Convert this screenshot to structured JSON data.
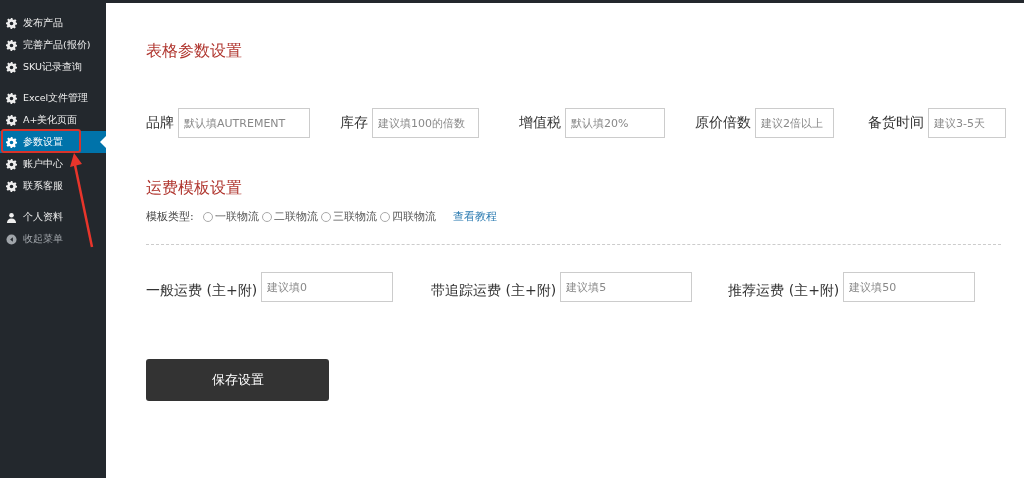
{
  "sidebar": {
    "groups": [
      {
        "items": [
          {
            "label": "发布产品",
            "kind": "gear",
            "selected": false
          },
          {
            "label": "完善产品(报价)",
            "kind": "gear",
            "selected": false
          },
          {
            "label": "SKU记录查询",
            "kind": "gear",
            "selected": false
          }
        ]
      },
      {
        "items": [
          {
            "label": "Excel文件管理",
            "kind": "gear",
            "selected": false
          },
          {
            "label": "A+美化页面",
            "kind": "gear",
            "selected": false
          },
          {
            "label": "参数设置",
            "kind": "gear",
            "selected": true
          },
          {
            "label": "账户中心",
            "kind": "gear",
            "selected": false
          },
          {
            "label": "联系客服",
            "kind": "gear",
            "selected": false
          }
        ]
      },
      {
        "items": [
          {
            "label": "个人资料",
            "kind": "person",
            "selected": false
          },
          {
            "label": "收起菜单",
            "kind": "collapse",
            "selected": false
          }
        ]
      }
    ]
  },
  "table_settings": {
    "title": "表格参数设置",
    "fields": [
      {
        "label": "品牌",
        "placeholder": "默认填AUTREMENT"
      },
      {
        "label": "库存",
        "placeholder": "建议填100的倍数"
      },
      {
        "label": "增值税",
        "placeholder": "默认填20%"
      },
      {
        "label": "原价倍数",
        "placeholder": "建议2倍以上"
      },
      {
        "label": "备货时间",
        "placeholder": "建议3-5天"
      }
    ]
  },
  "shipping_settings": {
    "title": "运费模板设置",
    "template_label": "模板类型:",
    "options": [
      {
        "label": "一联物流",
        "selected": false
      },
      {
        "label": "二联物流",
        "selected": false
      },
      {
        "label": "三联物流",
        "selected": false
      },
      {
        "label": "四联物流",
        "selected": false
      }
    ],
    "tutorial_link": "查看教程",
    "fields": [
      {
        "label": "一般运费 (主+附)",
        "placeholder": "建议填0"
      },
      {
        "label": "带追踪运费 (主+附)",
        "placeholder": "建议填5"
      },
      {
        "label": "推荐运费 (主+附)",
        "placeholder": "建议填50"
      }
    ]
  },
  "save_button": "保存设置"
}
